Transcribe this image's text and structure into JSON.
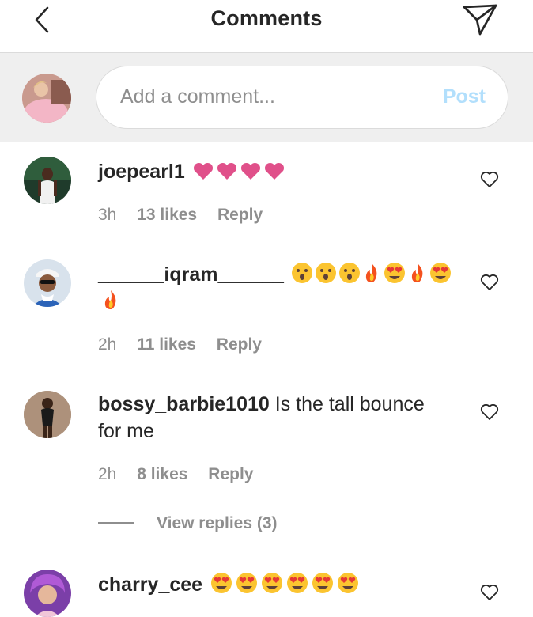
{
  "header": {
    "title": "Comments"
  },
  "composer": {
    "placeholder": "Add a comment...",
    "post_label": "Post"
  },
  "comments": [
    {
      "username": "joepearl1",
      "text": "",
      "emojis": [
        "pink-heart",
        "pink-heart",
        "pink-heart",
        "pink-heart"
      ],
      "time": "3h",
      "likes": "13 likes",
      "reply": "Reply"
    },
    {
      "username": "______iqram______",
      "text": "",
      "emojis": [
        "hushed-face",
        "hushed-face",
        "hushed-face",
        "fire",
        "heart-eyes",
        "fire",
        "heart-eyes",
        "fire"
      ],
      "time": "2h",
      "likes": "11 likes",
      "reply": "Reply"
    },
    {
      "username": "bossy_barbie1010",
      "text": "Is the tall bounce for me",
      "emojis": [],
      "time": "2h",
      "likes": "8 likes",
      "reply": "Reply",
      "view_replies": "View replies (3)"
    },
    {
      "username": "charry_cee",
      "text": "",
      "emojis": [
        "heart-eyes",
        "heart-eyes",
        "heart-eyes",
        "heart-eyes",
        "heart-eyes",
        "heart-eyes"
      ]
    }
  ],
  "colors": {
    "accent_disabled": "#b2dffc",
    "secondary_text": "#8e8e8e",
    "emoji_pink_heart": "#e0508a",
    "emoji_yellow": "#fbc430",
    "emoji_fire": "#f4511e"
  }
}
